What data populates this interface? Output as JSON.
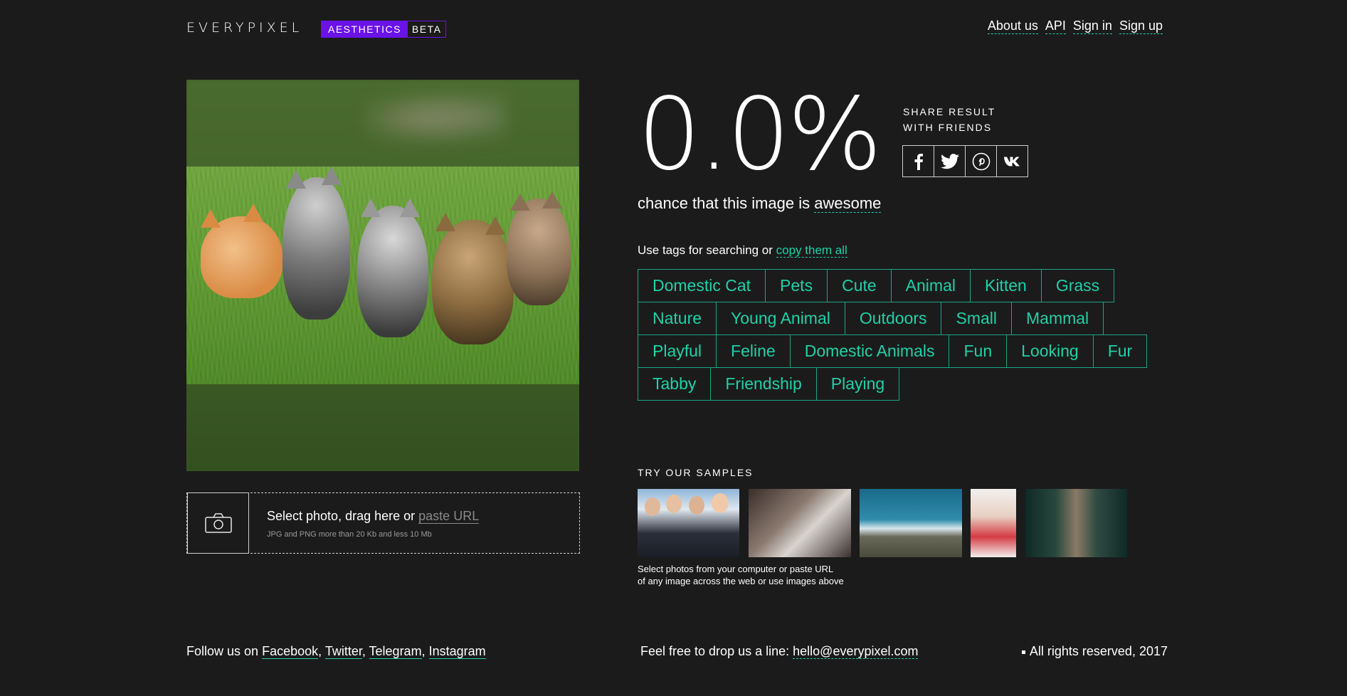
{
  "header": {
    "logo": "EVERYPIXEL",
    "badge_main": "AESTHETICS",
    "badge_beta": "BETA",
    "nav": [
      "About us",
      "API",
      "Sign in",
      "Sign up"
    ]
  },
  "upload": {
    "prompt": "Select photo, drag here or",
    "url_placeholder": "paste URL",
    "hint": "JPG and PNG more than 20 Kb and less 10 Mb"
  },
  "result": {
    "percent": "0.0%",
    "chance_text": "chance that this image is",
    "chance_word": "awesome",
    "share_line1": "SHARE RESULT",
    "share_line2": "WITH FRIENDS"
  },
  "social_icons": [
    "facebook-icon",
    "twitter-icon",
    "pinterest-icon",
    "vk-icon"
  ],
  "tags_intro": "Use tags for searching or",
  "tags_copy": "copy them all",
  "tags": [
    "Domestic Cat",
    "Pets",
    "Cute",
    "Animal",
    "Kitten",
    "Grass",
    "Nature",
    "Young Animal",
    "Outdoors",
    "Small",
    "Mammal",
    "Playful",
    "Feline",
    "Domestic Animals",
    "Fun",
    "Looking",
    "Fur",
    "Tabby",
    "Friendship",
    "Playing"
  ],
  "samples": {
    "title": "TRY OUR SAMPLES",
    "line1": "Select photos from your computer or paste URL",
    "line2": "of any image across the web or use images above"
  },
  "footer": {
    "follow": "Follow us on",
    "links": [
      "Facebook",
      "Twitter",
      "Telegram",
      "Instagram"
    ],
    "drop": "Feel free to drop us a line:",
    "email": "hello@everypixel.com",
    "rights": "All rights reserved, 2017"
  }
}
